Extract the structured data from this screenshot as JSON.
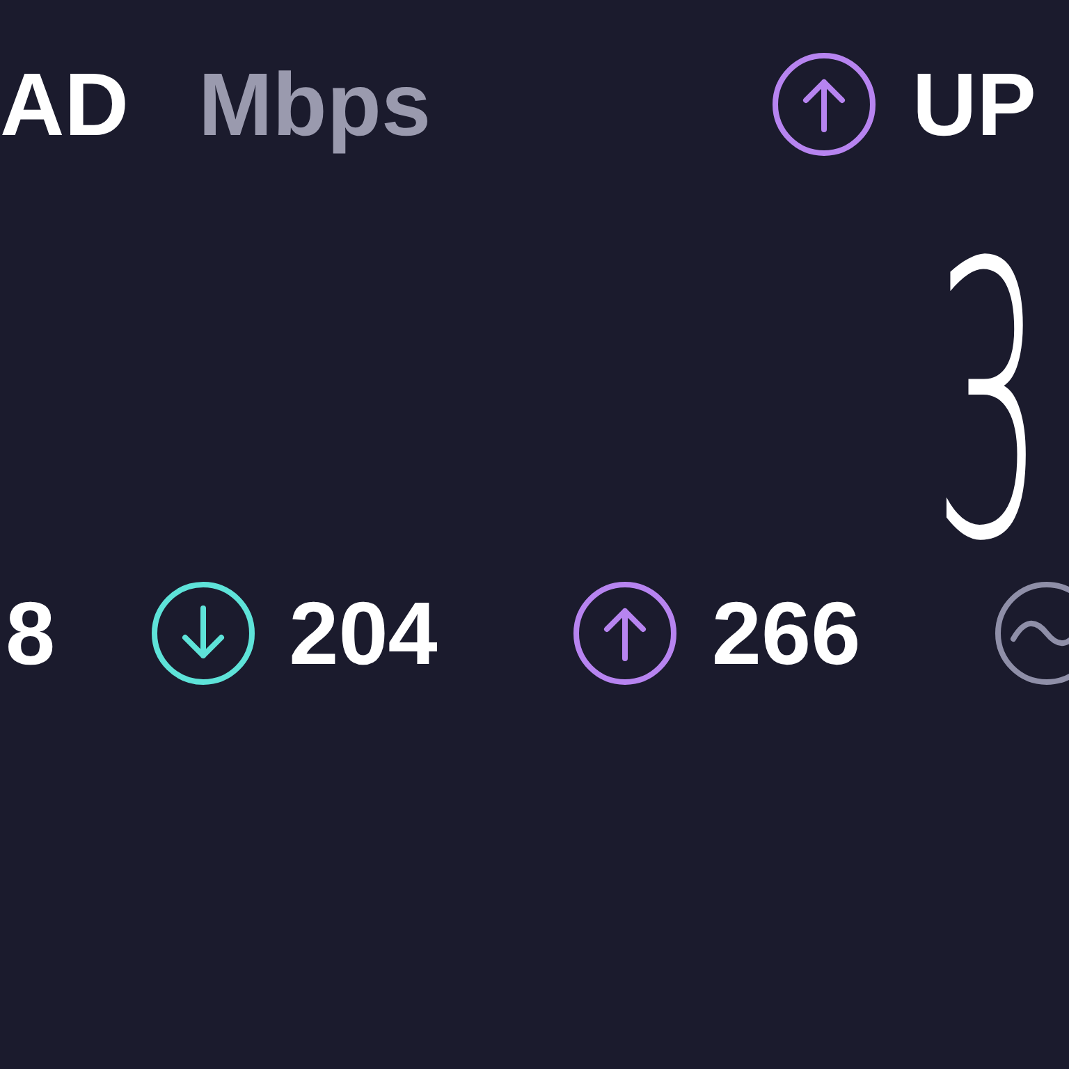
{
  "header": {
    "download_label": "AD",
    "unit": "Mbps",
    "upload_label": "UP"
  },
  "upload_value": "3",
  "stats": [
    {
      "kind": "plain",
      "value": "8"
    },
    {
      "kind": "download",
      "value": "204"
    },
    {
      "kind": "upload",
      "value": "266"
    },
    {
      "kind": "jitter"
    }
  ]
}
